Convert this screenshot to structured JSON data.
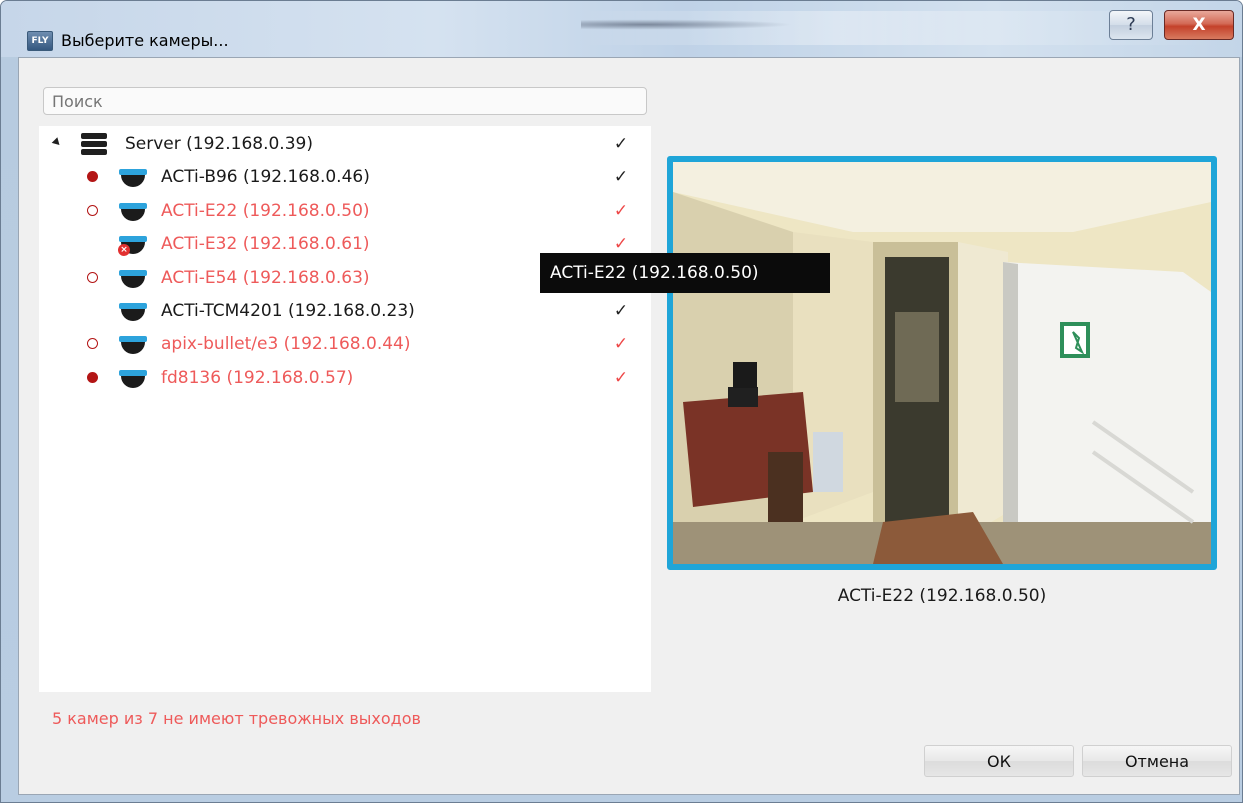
{
  "window": {
    "title": "Выберите камеры...",
    "app_icon_text": "FLY",
    "help_label": "?",
    "close_label": "X"
  },
  "search": {
    "placeholder": "Поиск",
    "value": ""
  },
  "tree": {
    "server": {
      "label": "Server (192.168.0.39)",
      "checked": true
    },
    "cameras": [
      {
        "label": "ACTi-B96 (192.168.0.46)",
        "color": "black",
        "indicator": "filled",
        "error": false,
        "checked": true
      },
      {
        "label": "ACTi-E22 (192.168.0.50)",
        "color": "red",
        "indicator": "hollow",
        "error": false,
        "checked": true
      },
      {
        "label": "ACTi-E32 (192.168.0.61)",
        "color": "red",
        "indicator": "none",
        "error": true,
        "checked": true
      },
      {
        "label": "ACTi-E54 (192.168.0.63)",
        "color": "red",
        "indicator": "hollow",
        "error": false,
        "checked": true
      },
      {
        "label": "ACTi-TCM4201 (192.168.0.23)",
        "color": "black",
        "indicator": "none",
        "error": false,
        "checked": true
      },
      {
        "label": "apix-bullet/e3 (192.168.0.44)",
        "color": "red",
        "indicator": "hollow",
        "error": false,
        "checked": true
      },
      {
        "label": "fd8136 (192.168.0.57)",
        "color": "red",
        "indicator": "filled",
        "error": false,
        "checked": true
      }
    ],
    "check_mark": "✓"
  },
  "tooltip": {
    "text": "ACTi-E22 (192.168.0.50)"
  },
  "preview": {
    "caption": "ACTi-E22 (192.168.0.50)"
  },
  "status_message": "5 камер из 7 не имеют тревожных выходов",
  "buttons": {
    "ok": "ОК",
    "cancel": "Отмена"
  },
  "colors": {
    "error_text": "#ee5a5a",
    "indicator": "#b31515",
    "preview_border": "#1fa5d8",
    "camera_icon_top": "#2da3dc"
  }
}
